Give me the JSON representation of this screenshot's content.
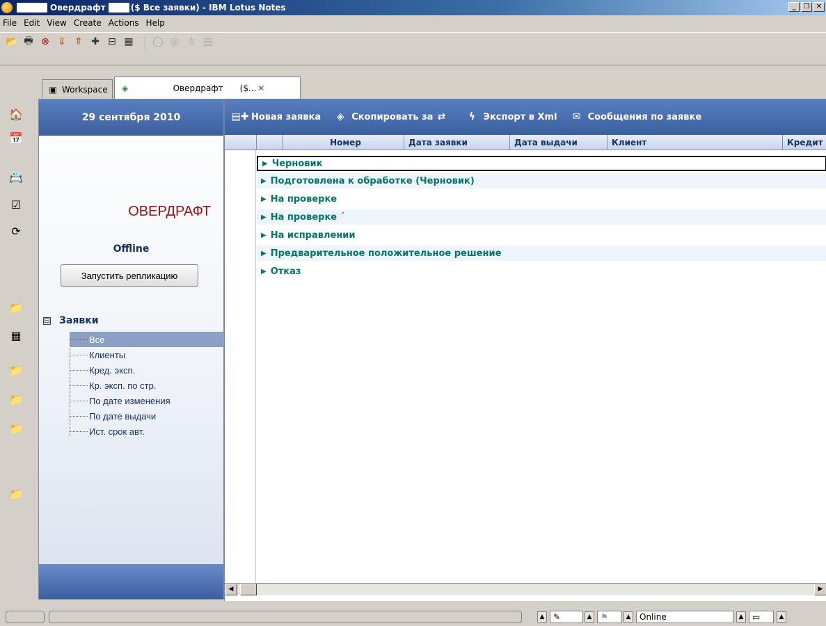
{
  "window": {
    "title_part1": "Овердрафт",
    "title_part2": "($ Все заявки) - IBM Lotus Notes",
    "controls": {
      "minimize": "_",
      "maximize": "❐",
      "close": "✕"
    }
  },
  "menu": [
    {
      "label": "File"
    },
    {
      "label": "Edit"
    },
    {
      "label": "View"
    },
    {
      "label": "Create"
    },
    {
      "label": "Actions"
    },
    {
      "label": "Help"
    }
  ],
  "tabs": {
    "workspace": "Workspace",
    "active_name": "Овердрафт",
    "active_suffix": "($...",
    "close_glyph": "✕"
  },
  "nav": {
    "date": "29 сентября 2010",
    "title": "ОВЕРДРАФТ",
    "status": "Offline",
    "replicate_button": "Запустить репликацию",
    "tree_toggle": "⊟",
    "tree_root": "Заявки",
    "tree_items": [
      "Все",
      "Клиенты",
      "Кред. эксп.",
      "Кр. эксп. по стр.",
      "По дате изменения",
      "По дате выдачи",
      "Ист. срок авт."
    ]
  },
  "actions": {
    "new": "Новая заявка",
    "copy": "Скопировать за",
    "export": "Экспорт в Xml",
    "messages": "Сообщения по заявке"
  },
  "columns": {
    "number": "Номер",
    "request_date": "Дата заявки",
    "issue_date": "Дата выдачи",
    "client": "Клиент",
    "credit": "Кредит"
  },
  "categories": [
    "Черновик",
    "Подготовлена к обработке (Черновик)",
    "На проверке",
    "На проверке ´",
    "На исправлении",
    "Предварительное положительное решение",
    "Отказ"
  ],
  "status": {
    "online": "Online"
  },
  "colors": {
    "accent_blue": "#3b5f9f",
    "category_text": "#00776a",
    "nav_title": "#a01010"
  }
}
